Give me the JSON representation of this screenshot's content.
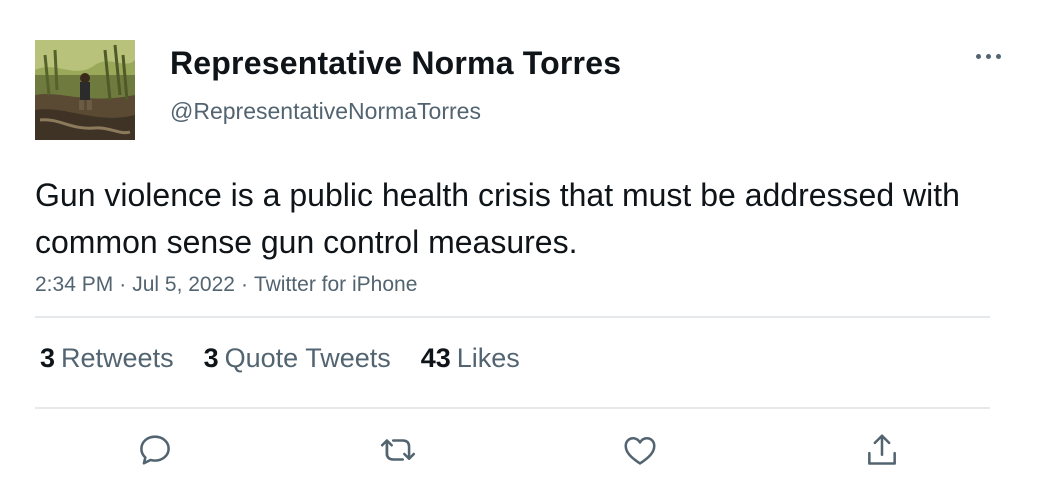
{
  "tweet": {
    "author": {
      "display_name": "Representative Norma Torres",
      "handle": "@RepresentativeNormaTorres"
    },
    "text": "Gun violence is a public health crisis that must be addressed with common sense gun control measures.",
    "time": "2:34 PM",
    "date": "Jul 5, 2022",
    "source": "Twitter for iPhone",
    "separator": "·"
  },
  "stats": {
    "retweets": {
      "count": "3",
      "label": "Retweets"
    },
    "quote_tweets": {
      "count": "3",
      "label": "Quote Tweets"
    },
    "likes": {
      "count": "43",
      "label": "Likes"
    }
  },
  "icons": {
    "more": "more-horizontal-icon",
    "reply": "reply-icon",
    "retweet": "retweet-icon",
    "like": "heart-icon",
    "share": "share-icon"
  },
  "colors": {
    "text_primary": "#0f1419",
    "text_secondary": "#536471",
    "divider": "#e6e9eb",
    "background": "#ffffff"
  }
}
